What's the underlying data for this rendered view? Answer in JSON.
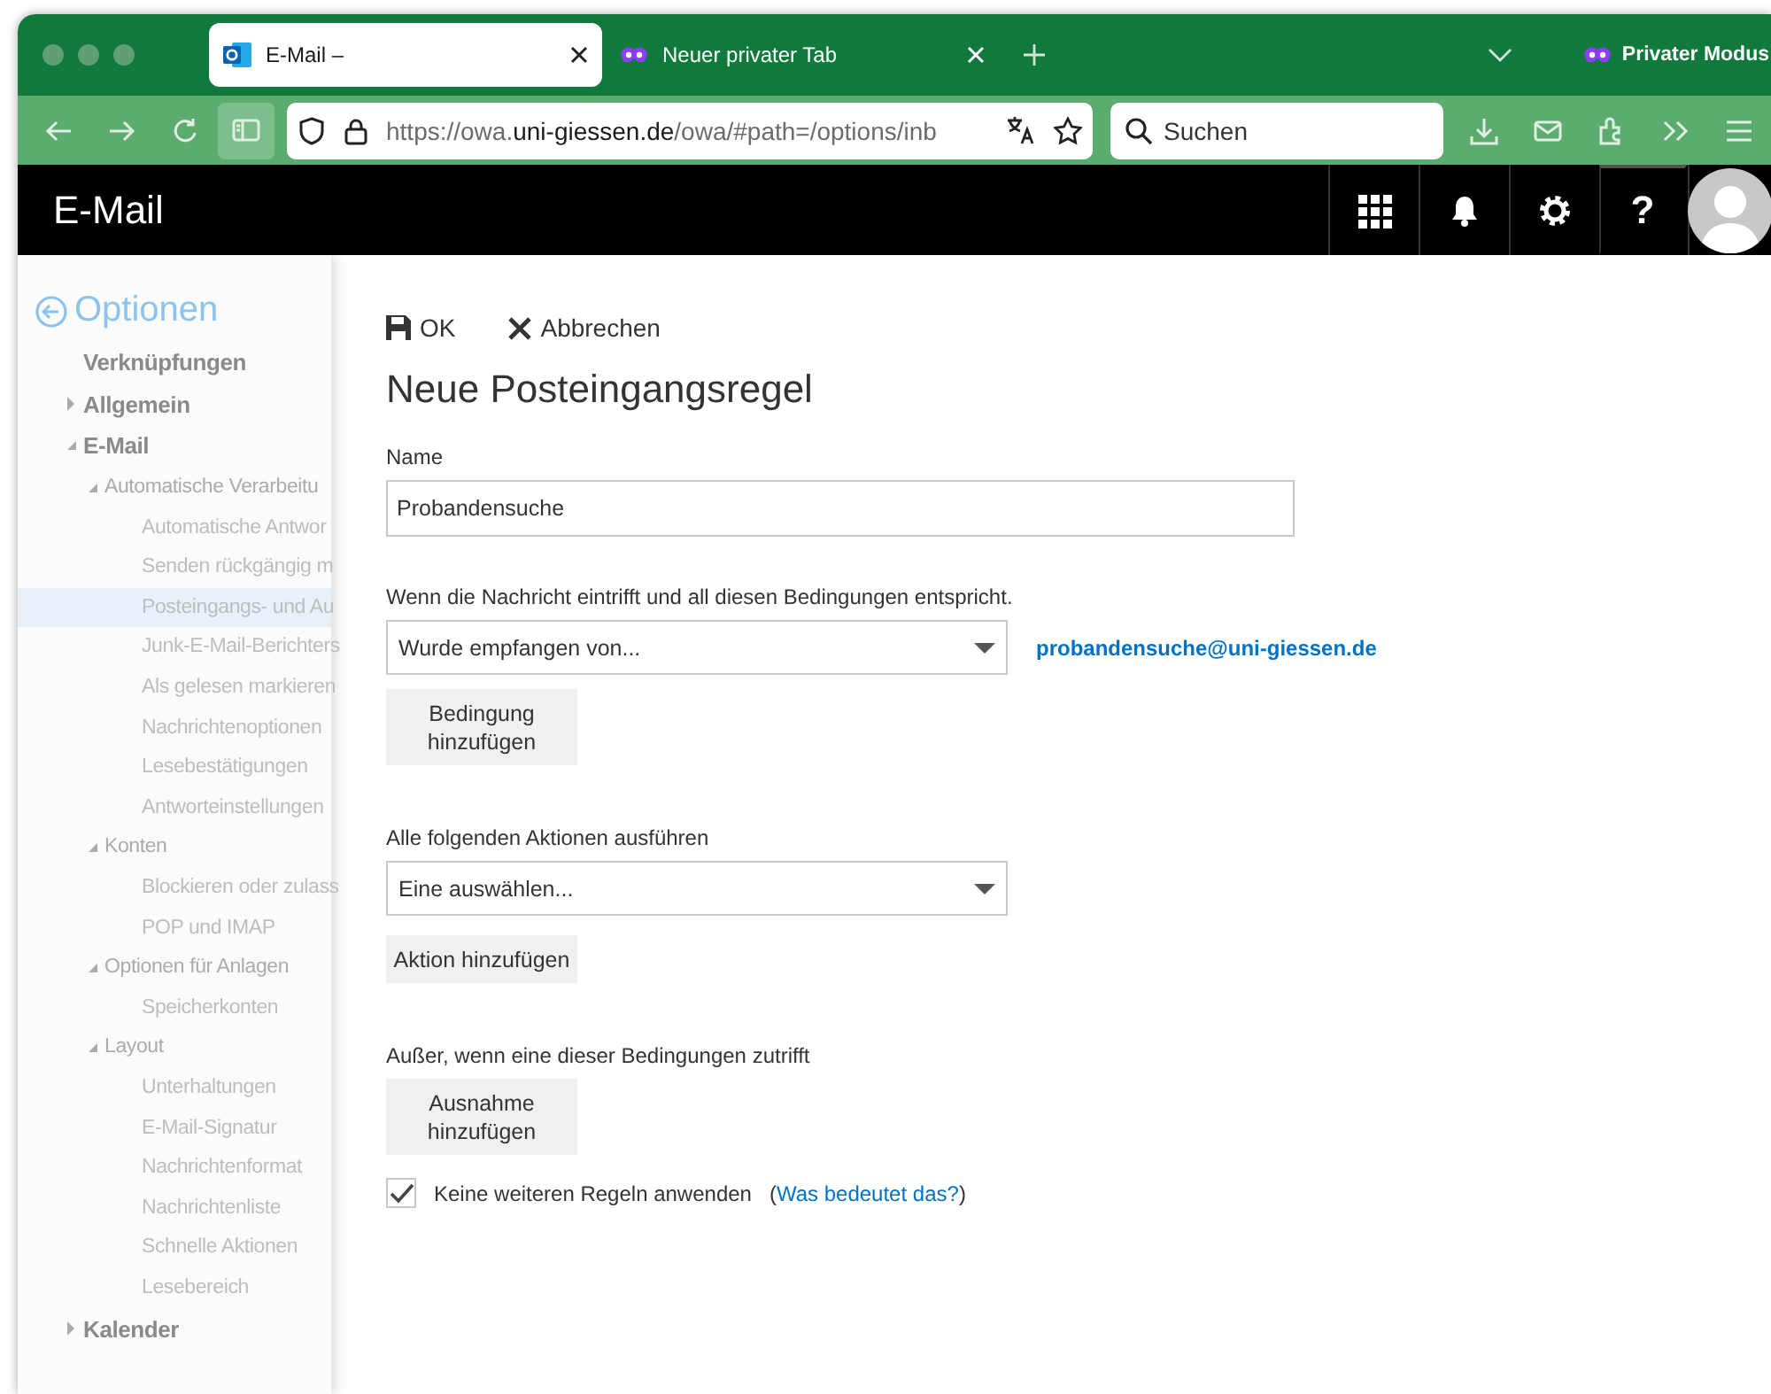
{
  "browser": {
    "tabs": [
      {
        "title": "E-Mail –",
        "kind": "mail",
        "selected": true
      },
      {
        "title": "Neuer privater Tab",
        "kind": "private",
        "selected": false
      }
    ],
    "private_mode": "Privater Modus",
    "url": {
      "scheme": "https://owa.",
      "domain": "uni-giessen.de",
      "path": "/owa/#path=/options/inb"
    },
    "search": {
      "placeholder": "Suchen"
    }
  },
  "header": {
    "title": "E-Mail",
    "help": "?"
  },
  "sidebar": {
    "title": "Optionen",
    "items": [
      {
        "label": "Verknüpfungen",
        "selected": false
      },
      {
        "label": "Allgemein",
        "expanded": false,
        "selected": false
      },
      {
        "label": "E-Mail",
        "expanded": true,
        "selected": false,
        "children": [
          {
            "label": "Automatische Verarbeitu",
            "expanded": true,
            "selected": false,
            "children": [
              {
                "label": "Automatische Antwor",
                "selected": false
              },
              {
                "label": "Senden rückgängig m",
                "selected": false
              },
              {
                "label": "Posteingangs- und Au",
                "selected": true
              },
              {
                "label": "Junk-E-Mail-Berichters",
                "selected": false
              },
              {
                "label": "Als gelesen markieren",
                "selected": false
              },
              {
                "label": "Nachrichtenoptionen",
                "selected": false
              },
              {
                "label": "Lesebestätigungen",
                "selected": false
              },
              {
                "label": "Antworteinstellungen",
                "selected": false
              }
            ]
          },
          {
            "label": "Konten",
            "expanded": true,
            "selected": false,
            "children": [
              {
                "label": "Blockieren oder zulass",
                "selected": false
              },
              {
                "label": "POP und IMAP",
                "selected": false
              }
            ]
          },
          {
            "label": "Optionen für Anlagen",
            "expanded": true,
            "selected": false,
            "children": [
              {
                "label": "Speicherkonten",
                "selected": false
              }
            ]
          },
          {
            "label": "Layout",
            "expanded": true,
            "selected": false,
            "children": [
              {
                "label": "Unterhaltungen",
                "selected": false
              },
              {
                "label": "E-Mail-Signatur",
                "selected": false
              },
              {
                "label": "Nachrichtenformat",
                "selected": false
              },
              {
                "label": "Nachrichtenliste",
                "selected": false
              },
              {
                "label": "Schnelle Aktionen",
                "selected": false
              },
              {
                "label": "Lesebereich",
                "selected": false
              }
            ]
          }
        ]
      },
      {
        "label": "Kalender",
        "expanded": false,
        "selected": false
      }
    ]
  },
  "toolbar": {
    "ok": "OK",
    "cancel": "Abbrechen"
  },
  "form": {
    "title": "Neue Posteingangsregel",
    "name_label": "Name",
    "name_value": "Probandensuche",
    "conditions_label": "Wenn die Nachricht eintrifft und all diesen Bedingungen entspricht.",
    "condition_select": "Wurde empfangen von...",
    "condition_value": "probandensuche@uni-giessen.de",
    "add_condition": "Bedingung hinzufügen",
    "actions_label": "Alle folgenden Aktionen ausführen",
    "action_select": "Eine auswählen...",
    "add_action": "Aktion hinzufügen",
    "exceptions_label": "Außer, wenn eine dieser Bedingungen zutrifft",
    "add_exception": "Ausnahme hinzufügen",
    "stop_rules": {
      "label": "Keine weiteren Regeln anwenden",
      "checked": true,
      "open": "(",
      "link": "Was bedeutet das?",
      "close": ")"
    }
  }
}
